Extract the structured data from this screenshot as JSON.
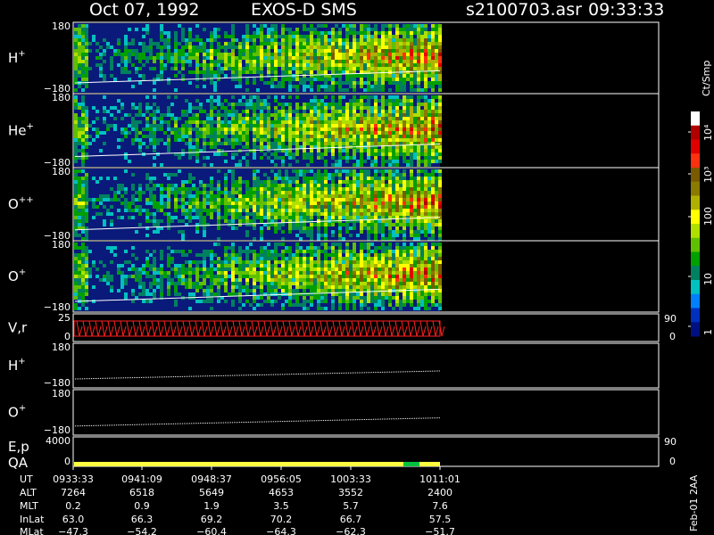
{
  "header": {
    "date": "Oct 07, 1992",
    "mission": "EXOS-D SMS",
    "file": "s2100703.asr",
    "time": "09:33:33"
  },
  "colorbar": {
    "unit": "Ct/Smp",
    "ticks": [
      "10⁴",
      "10³",
      "100",
      "10",
      "1"
    ],
    "colors": [
      "#ffffff",
      "#b00000",
      "#e00000",
      "#ff3010",
      "#7a5a00",
      "#8a7a00",
      "#b0b000",
      "#ffff00",
      "#b0e000",
      "#60c000",
      "#00a000",
      "#008060",
      "#00c0c0",
      "#0080ff",
      "#0030c0",
      "#001080"
    ]
  },
  "footer_tag": "Feb-01 2AA",
  "colors": {
    "background": "#000000",
    "panel_bg": "#0a1a7a",
    "vr_trace": "#ff2020",
    "qa_bar": "#ffff40",
    "qa_flag": "#00c040"
  },
  "chart_data": {
    "type": "heatmap",
    "x_ticks": [
      "0933:33",
      "0941:09",
      "0948:37",
      "0956:05",
      "1003:33",
      "1011:01"
    ],
    "panels": [
      {
        "label": "H",
        "sup": "+",
        "ymax": "180",
        "ymin": "−180",
        "kind": "spectrogram"
      },
      {
        "label": "He",
        "sup": "+",
        "ymax": "180",
        "ymin": "−180",
        "kind": "spectrogram"
      },
      {
        "label": "O",
        "sup": "++",
        "ymax": "180",
        "ymin": "−180",
        "kind": "spectrogram"
      },
      {
        "label": "O",
        "sup": "+",
        "ymax": "180",
        "ymin": "−180",
        "kind": "spectrogram"
      },
      {
        "label": "V,r",
        "sup": "",
        "ymax": "25",
        "ymin": "0",
        "right_top": "90",
        "right_bottom": "0",
        "kind": "vr"
      },
      {
        "label": "H",
        "sup": "+",
        "ymax": "180",
        "ymin": "−180",
        "kind": "line"
      },
      {
        "label": "O",
        "sup": "+",
        "ymax": "180",
        "ymin": "−180",
        "kind": "line"
      },
      {
        "label": "E,p",
        "sup": "",
        "ymax": "4000",
        "ymin": "0",
        "right_top": "90",
        "right_bottom": "0",
        "kind": "ep",
        "label2": "QA"
      }
    ],
    "orbit_table": {
      "rows": [
        {
          "name": "UT",
          "values": [
            "0933:33",
            "0941:09",
            "0948:37",
            "0956:05",
            "1003:33",
            "1011:01"
          ]
        },
        {
          "name": "ALT",
          "values": [
            "7264",
            "6518",
            "5649",
            "4653",
            "3552",
            "2400"
          ]
        },
        {
          "name": "MLT",
          "values": [
            "0.2",
            "0.9",
            "1.9",
            "3.5",
            "5.7",
            "7.6"
          ]
        },
        {
          "name": "InLat",
          "values": [
            "63.0",
            "66.3",
            "69.2",
            "70.2",
            "66.7",
            "57.5"
          ]
        },
        {
          "name": "MLat",
          "values": [
            "−47.3",
            "−54.2",
            "−60.4",
            "−64.3",
            "−62.3",
            "−51.7"
          ]
        }
      ]
    }
  }
}
